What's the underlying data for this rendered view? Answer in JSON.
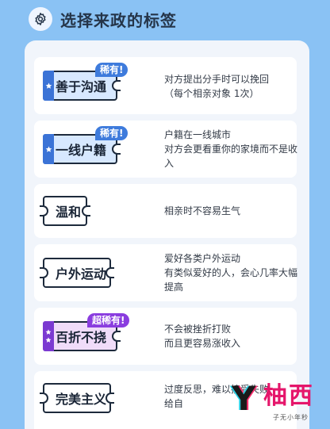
{
  "header": {
    "icon": "gear-icon",
    "title": "选择来政的标签"
  },
  "tags": [
    {
      "label": "善于沟通",
      "badge": "稀有!",
      "rarity": "rare",
      "stars": 1,
      "desc": [
        "对方提出分手时可以挽回",
        "（每个相亲对象 1次）"
      ]
    },
    {
      "label": "一线户籍",
      "badge": "稀有!",
      "rarity": "rare",
      "stars": 1,
      "desc": [
        "户籍在一线城市",
        "对方会更看重你的家境而不是收",
        "入"
      ]
    },
    {
      "label": "温和",
      "badge": "",
      "rarity": "common",
      "stars": 0,
      "desc": [
        "相亲时不容易生气"
      ]
    },
    {
      "label": "户外运动",
      "badge": "",
      "rarity": "common",
      "stars": 0,
      "desc": [
        "爱好各类户外运动",
        "有类似爱好的人，会心几率大幅",
        "提高"
      ]
    },
    {
      "label": "百折不挠",
      "badge": "超稀有!",
      "rarity": "super-rare",
      "stars": 2,
      "desc": [
        "不会被挫折打败",
        "而且更容易涨收入"
      ]
    },
    {
      "label": "完美主义",
      "badge": "",
      "rarity": "common",
      "stars": 0,
      "desc": [
        "过度反思，难以接受失败",
        "给自"
      ]
    }
  ],
  "watermark": {
    "logo": "Y",
    "text": "柚西",
    "sub": "子无小年秒"
  },
  "colors": {
    "background": "#8ac2f4",
    "panel": "#f1f5fb",
    "rare": "#3e7bdc",
    "super_rare": "#8a3ddf",
    "watermark": "#e5166b"
  }
}
